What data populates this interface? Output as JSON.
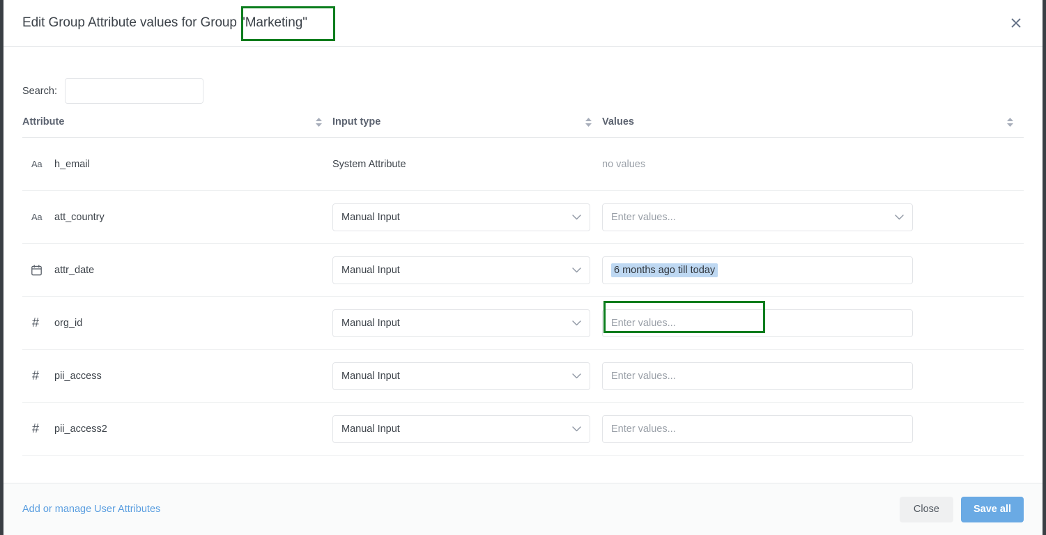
{
  "dialog": {
    "title_prefix": "Edit Group Attribute values for Group",
    "title_group": "\"Marketing\"",
    "close_icon": "close-icon"
  },
  "search": {
    "label": "Search:",
    "value": "",
    "placeholder": ""
  },
  "table": {
    "columns": [
      {
        "label": "Attribute",
        "sortable": true
      },
      {
        "label": "Input type",
        "sortable": true
      },
      {
        "label": "Values",
        "sortable": true
      }
    ],
    "rows": [
      {
        "icon": "text-type-icon",
        "icon_glyph": "Aa",
        "name": "h_email",
        "input_type_text": "System Attribute",
        "input_type_is_select": false,
        "values_text": "no values",
        "values_is_field": false,
        "values_has_dropdown": false,
        "values_filled": false
      },
      {
        "icon": "text-type-icon",
        "icon_glyph": "Aa",
        "name": "att_country",
        "input_type_text": "Manual Input",
        "input_type_is_select": true,
        "values_text": "Enter values...",
        "values_is_field": true,
        "values_has_dropdown": true,
        "values_filled": false
      },
      {
        "icon": "calendar-icon",
        "icon_glyph": "",
        "name": "attr_date",
        "input_type_text": "Manual Input",
        "input_type_is_select": true,
        "values_text": "6 months ago till today",
        "values_is_field": true,
        "values_has_dropdown": false,
        "values_filled": true
      },
      {
        "icon": "number-type-icon",
        "icon_glyph": "#",
        "name": "org_id",
        "input_type_text": "Manual Input",
        "input_type_is_select": true,
        "values_text": "Enter values...",
        "values_is_field": true,
        "values_has_dropdown": false,
        "values_filled": false
      },
      {
        "icon": "number-type-icon",
        "icon_glyph": "#",
        "name": "pii_access",
        "input_type_text": "Manual Input",
        "input_type_is_select": true,
        "values_text": "Enter values...",
        "values_is_field": true,
        "values_has_dropdown": false,
        "values_filled": false
      },
      {
        "icon": "number-type-icon",
        "icon_glyph": "#",
        "name": "pii_access2",
        "input_type_text": "Manual Input",
        "input_type_is_select": true,
        "values_text": "Enter values...",
        "values_is_field": true,
        "values_has_dropdown": false,
        "values_filled": false
      }
    ]
  },
  "footer": {
    "manage_link": "Add or manage User Attributes",
    "close_label": "Close",
    "save_label": "Save all"
  },
  "annotations": {
    "title_box_color": "#0b7d1d",
    "value_box_color": "#0b7d1d",
    "selection_highlight_color": "#bed8f2"
  },
  "colors": {
    "primary_button": "#6aaae4",
    "link": "#5a9ee0",
    "text": "#3d434a",
    "muted_text": "#9aa0a8",
    "border": "#e3e5e8"
  }
}
